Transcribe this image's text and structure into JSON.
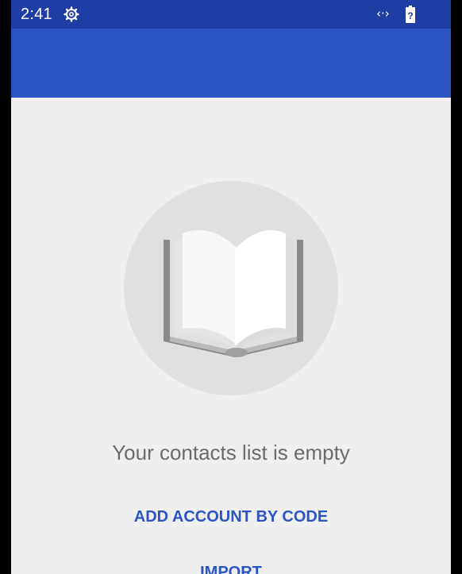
{
  "status_bar": {
    "time": "2:41",
    "settings_icon": "gear-icon",
    "data_icon": "data-transfer-icon",
    "data_glyph": "‹·›",
    "battery_icon": "battery-unknown-icon",
    "battery_glyph": "?"
  },
  "app_bar": {
    "title": "",
    "color": "#2c55c4"
  },
  "empty_state": {
    "icon": "open-book-icon",
    "message": "Your contacts list is empty"
  },
  "actions": {
    "add_account_label": "ADD ACCOUNT BY CODE",
    "import_label": "IMPORT"
  },
  "colors": {
    "status_bar": "#1f3ea4",
    "accent": "#2c55c4",
    "background": "#efefef"
  }
}
